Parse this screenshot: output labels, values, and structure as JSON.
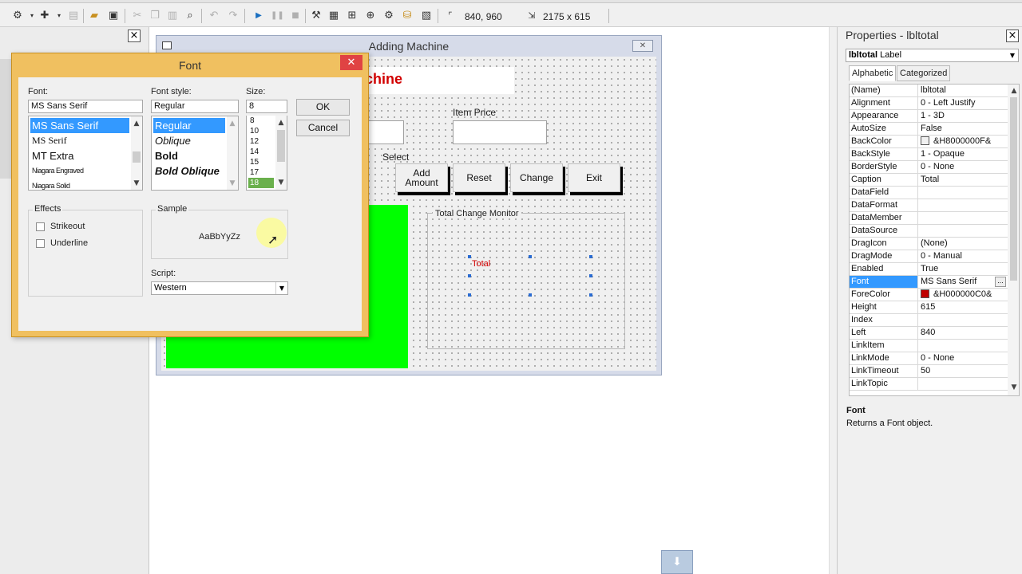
{
  "toolbar": {
    "cursor_position": "840, 960",
    "selection_size": "2175 x 615"
  },
  "adding_machine": {
    "title": "Adding Machine",
    "heading_fragment": "chine",
    "item_price_label": "Item Price",
    "select_label": "Select",
    "buttons": {
      "add": "Add Amount",
      "reset": "Reset",
      "change": "Change",
      "exit": "Exit"
    },
    "frame_label": "Total Change Monitor",
    "total_label": "Total"
  },
  "font_dialog": {
    "title": "Font",
    "font_label": "Font:",
    "font_value": "MS Sans Serif",
    "fonts": [
      "MS Sans Serif",
      "MS Serif",
      "MT Extra",
      "Niagara Engraved",
      "Niagara Solid"
    ],
    "style_label": "Font style:",
    "style_value": "Regular",
    "styles": [
      "Regular",
      "Oblique",
      "Bold",
      "Bold Oblique"
    ],
    "size_label": "Size:",
    "size_value": "8",
    "sizes": [
      "8",
      "10",
      "12",
      "14",
      "15",
      "17",
      "18"
    ],
    "ok": "OK",
    "cancel": "Cancel",
    "effects_label": "Effects",
    "strikeout": "Strikeout",
    "underline": "Underline",
    "sample_label": "Sample",
    "sample_text": "AaBbYyZz",
    "script_label": "Script:",
    "script_value": "Western"
  },
  "properties": {
    "title": "Properties - lbltotal",
    "object_name": "lbltotal",
    "object_type": "Label",
    "tabs": [
      "Alphabetic",
      "Categorized"
    ],
    "rows": [
      {
        "name": "(Name)",
        "value": "lbltotal"
      },
      {
        "name": "Alignment",
        "value": "0 - Left Justify"
      },
      {
        "name": "Appearance",
        "value": "1 - 3D"
      },
      {
        "name": "AutoSize",
        "value": "False"
      },
      {
        "name": "BackColor",
        "value": "&H8000000F&"
      },
      {
        "name": "BackStyle",
        "value": "1 - Opaque"
      },
      {
        "name": "BorderStyle",
        "value": "0 - None"
      },
      {
        "name": "Caption",
        "value": "Total"
      },
      {
        "name": "DataField",
        "value": ""
      },
      {
        "name": "DataFormat",
        "value": ""
      },
      {
        "name": "DataMember",
        "value": ""
      },
      {
        "name": "DataSource",
        "value": ""
      },
      {
        "name": "DragIcon",
        "value": "(None)"
      },
      {
        "name": "DragMode",
        "value": "0 - Manual"
      },
      {
        "name": "Enabled",
        "value": "True"
      },
      {
        "name": "Font",
        "value": "MS Sans Serif"
      },
      {
        "name": "ForeColor",
        "value": "&H000000C0&"
      },
      {
        "name": "Height",
        "value": "615"
      },
      {
        "name": "Index",
        "value": ""
      },
      {
        "name": "Left",
        "value": "840"
      },
      {
        "name": "LinkItem",
        "value": ""
      },
      {
        "name": "LinkMode",
        "value": "0 - None"
      },
      {
        "name": "LinkTimeout",
        "value": "50"
      },
      {
        "name": "LinkTopic",
        "value": ""
      }
    ],
    "description_name": "Font",
    "description_text": "Returns a Font object."
  },
  "colors": {
    "backcolor_swatch": "#f0f0f0",
    "forecolor_swatch": "#c00000",
    "green_panel": "#00ff00",
    "heading_red": "#d20000",
    "selection_blue": "#3399ff"
  }
}
